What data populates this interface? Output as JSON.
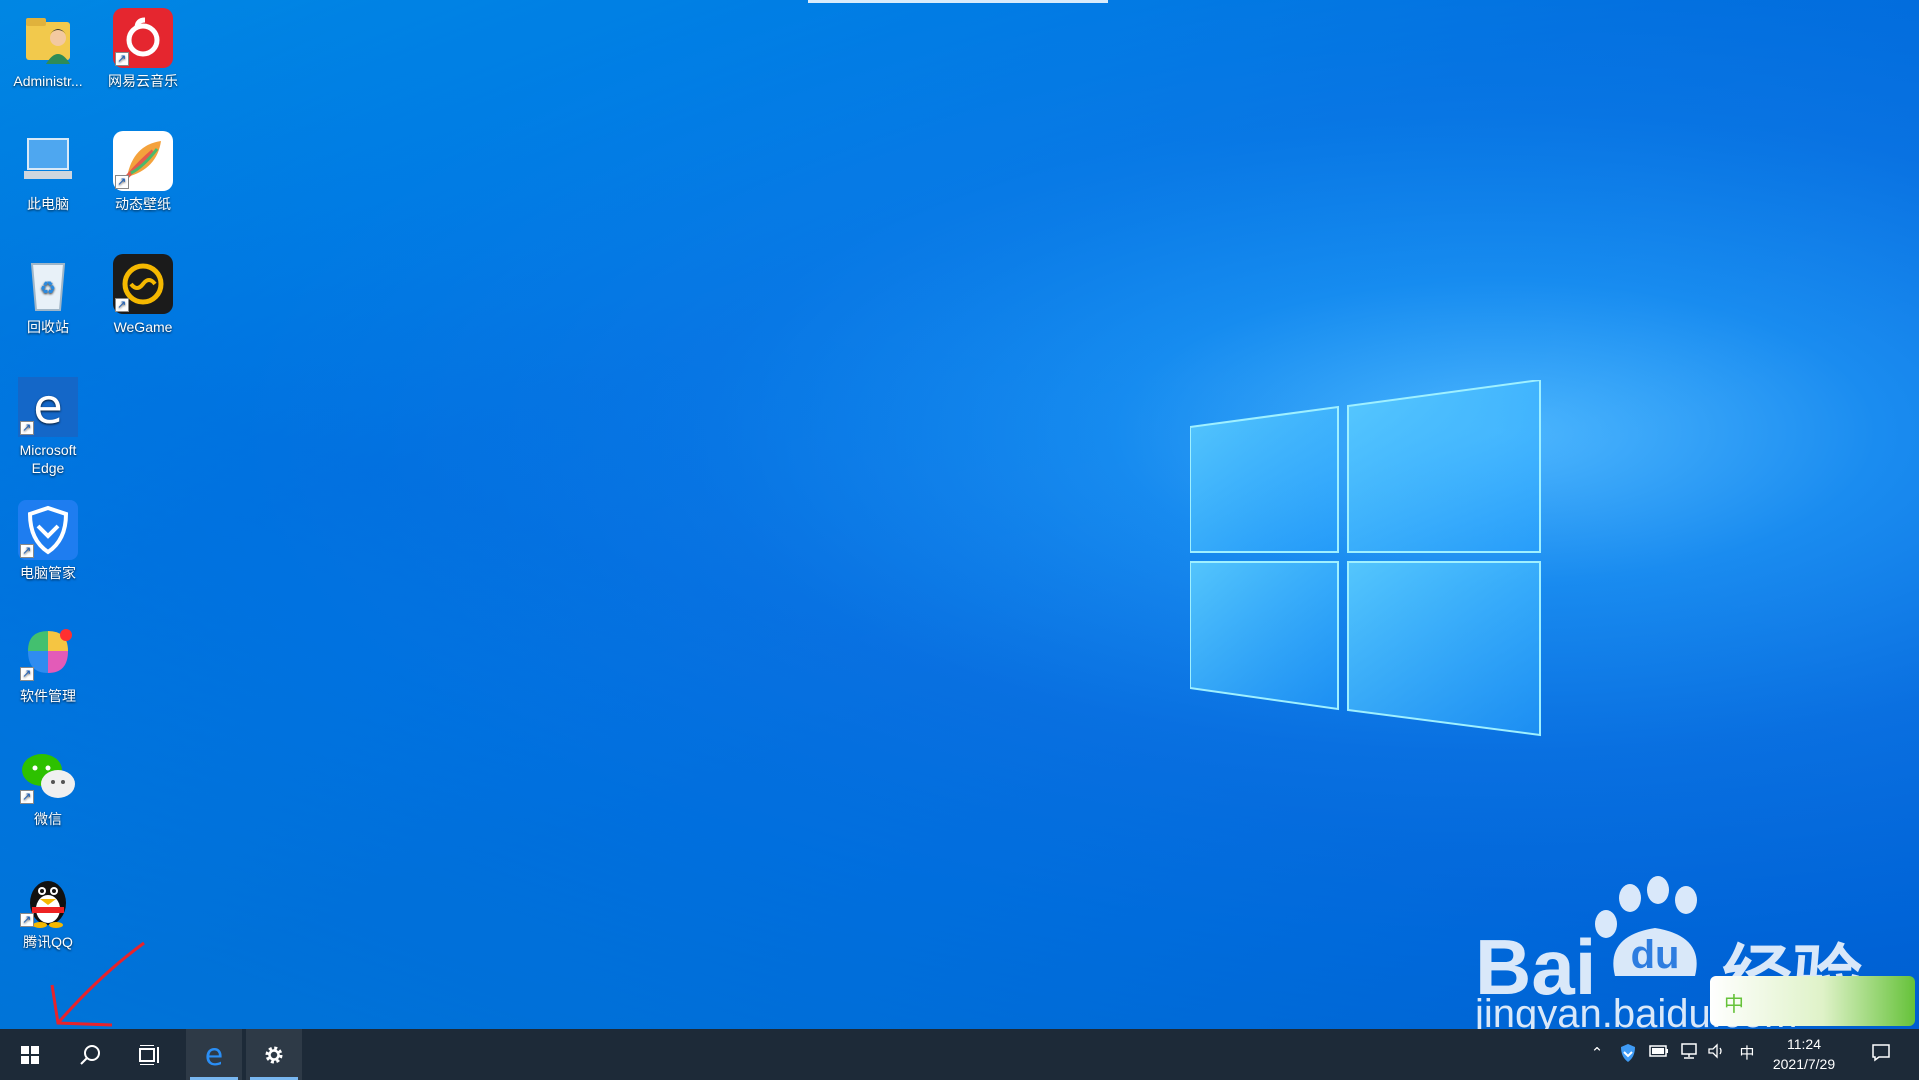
{
  "desktop": {
    "icons": [
      {
        "label": "Administr...",
        "icon": "user-folder-icon"
      },
      {
        "label": "网易云音乐",
        "icon": "netease-music-icon"
      },
      {
        "label": "此电脑",
        "icon": "this-pc-icon"
      },
      {
        "label": "动态壁纸",
        "icon": "dynamic-wallpaper-icon"
      },
      {
        "label": "回收站",
        "icon": "recycle-bin-icon"
      },
      {
        "label": "WeGame",
        "icon": "wegame-icon"
      },
      {
        "label": "Microsoft Edge",
        "icon": "edge-icon"
      },
      {
        "label": "电脑管家",
        "icon": "pc-manager-icon"
      },
      {
        "label": "软件管理",
        "icon": "software-manager-icon"
      },
      {
        "label": "微信",
        "icon": "wechat-icon"
      },
      {
        "label": "腾讯QQ",
        "icon": "qq-icon"
      }
    ],
    "colors": {
      "accent": "#0a6fe0",
      "taskbar": "#1d2a38"
    }
  },
  "taskbar": {
    "buttons": [
      {
        "name": "start-button",
        "icon": "windows-icon"
      },
      {
        "name": "search-button",
        "icon": "search-icon"
      },
      {
        "name": "task-view-button",
        "icon": "task-view-icon"
      },
      {
        "name": "edge-taskbar-button",
        "icon": "edge-icon"
      },
      {
        "name": "settings-taskbar-button",
        "icon": "gear-icon"
      }
    ],
    "tray": {
      "ime": "中",
      "time": "11:24",
      "date": "2021/7/29"
    }
  },
  "watermark": {
    "brand_left": "Bai",
    "brand_right": "经验",
    "url": "jingyan.baidu.com",
    "paw_text": "du",
    "badge": "中"
  }
}
